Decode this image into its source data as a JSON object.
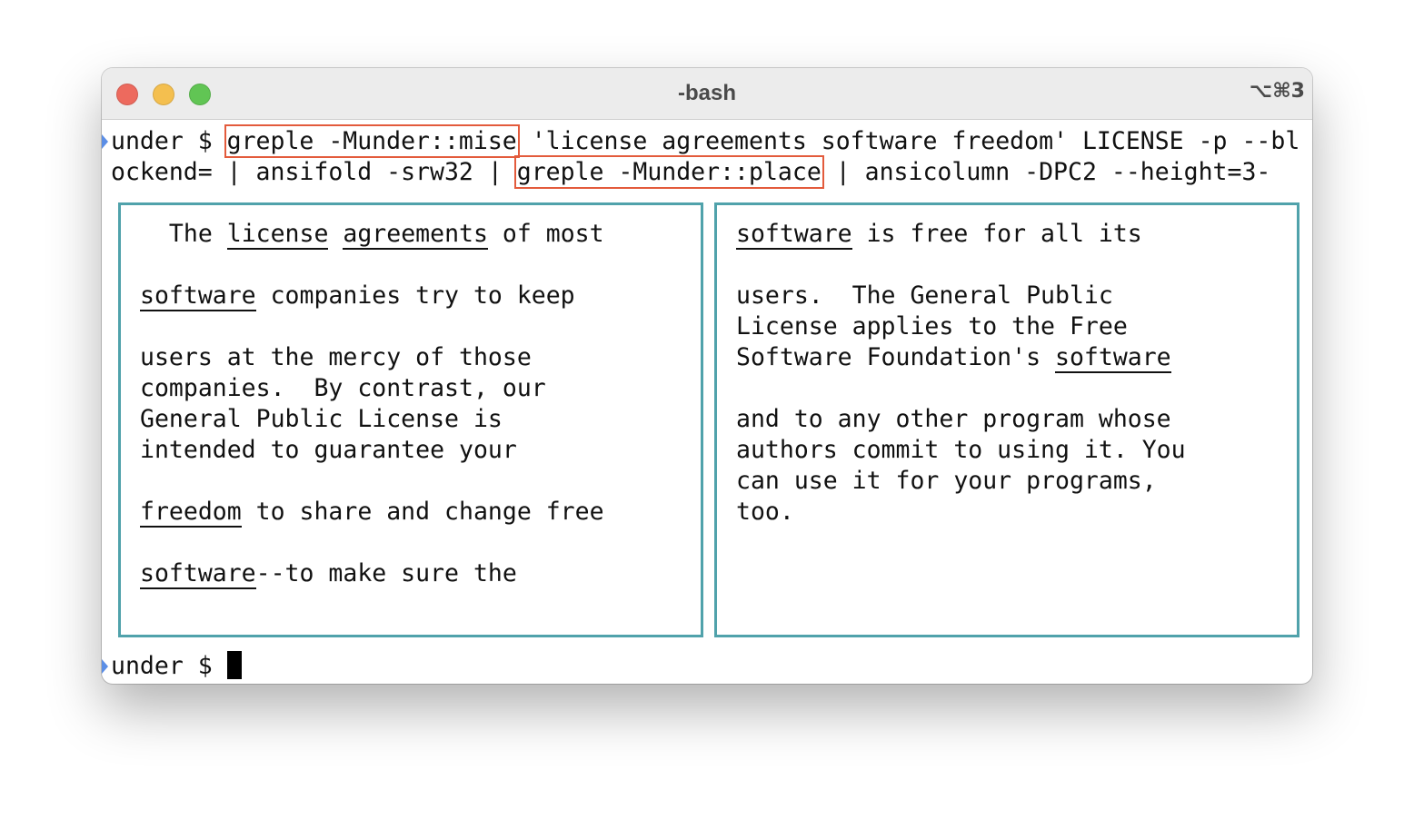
{
  "window": {
    "title": "-bash",
    "shortcut": "⌥⌘3"
  },
  "command": {
    "prompt": "under $ ",
    "highlight1": "greple -Munder::mise",
    "mid1": " 'license agreements software freedom' LICENSE -p --bl",
    "line2_start": "ockend= | ansifold -srw32 | ",
    "highlight2": "greple -Munder::place",
    "line2_end": " | ansicolumn -DPC2 --height=3-"
  },
  "left_column": [
    [
      {
        "t": "  The "
      },
      {
        "t": "license",
        "u": true
      },
      {
        "t": " "
      },
      {
        "t": "agreements",
        "u": true
      },
      {
        "t": " of most"
      }
    ],
    [],
    [
      {
        "t": "software",
        "u": true
      },
      {
        "t": " companies try to keep"
      }
    ],
    [],
    [
      {
        "t": "users at the mercy of those"
      }
    ],
    [
      {
        "t": "companies.  By contrast, our"
      }
    ],
    [
      {
        "t": "General Public License is"
      }
    ],
    [
      {
        "t": "intended to guarantee your"
      }
    ],
    [],
    [
      {
        "t": "freedom",
        "u": true
      },
      {
        "t": " to share and change free"
      }
    ],
    [],
    [
      {
        "t": "software",
        "u": true
      },
      {
        "t": "--to make sure the"
      }
    ]
  ],
  "right_column": [
    [
      {
        "t": "software",
        "u": true
      },
      {
        "t": " is free for all its"
      }
    ],
    [],
    [
      {
        "t": "users.  The General Public"
      }
    ],
    [
      {
        "t": "License applies to the Free"
      }
    ],
    [
      {
        "t": "Software Foundation's "
      },
      {
        "t": "software",
        "u": true
      }
    ],
    [],
    [
      {
        "t": "and to any other program whose"
      }
    ],
    [
      {
        "t": "authors commit to using it. You"
      }
    ],
    [
      {
        "t": "can use it for your programs,"
      }
    ],
    [
      {
        "t": "too."
      }
    ]
  ],
  "final_prompt": "under $ ",
  "colors": {
    "highlight_border": "#e35b3c",
    "column_border": "#50a2ab",
    "prompt_marker": "#5b8ee6"
  }
}
